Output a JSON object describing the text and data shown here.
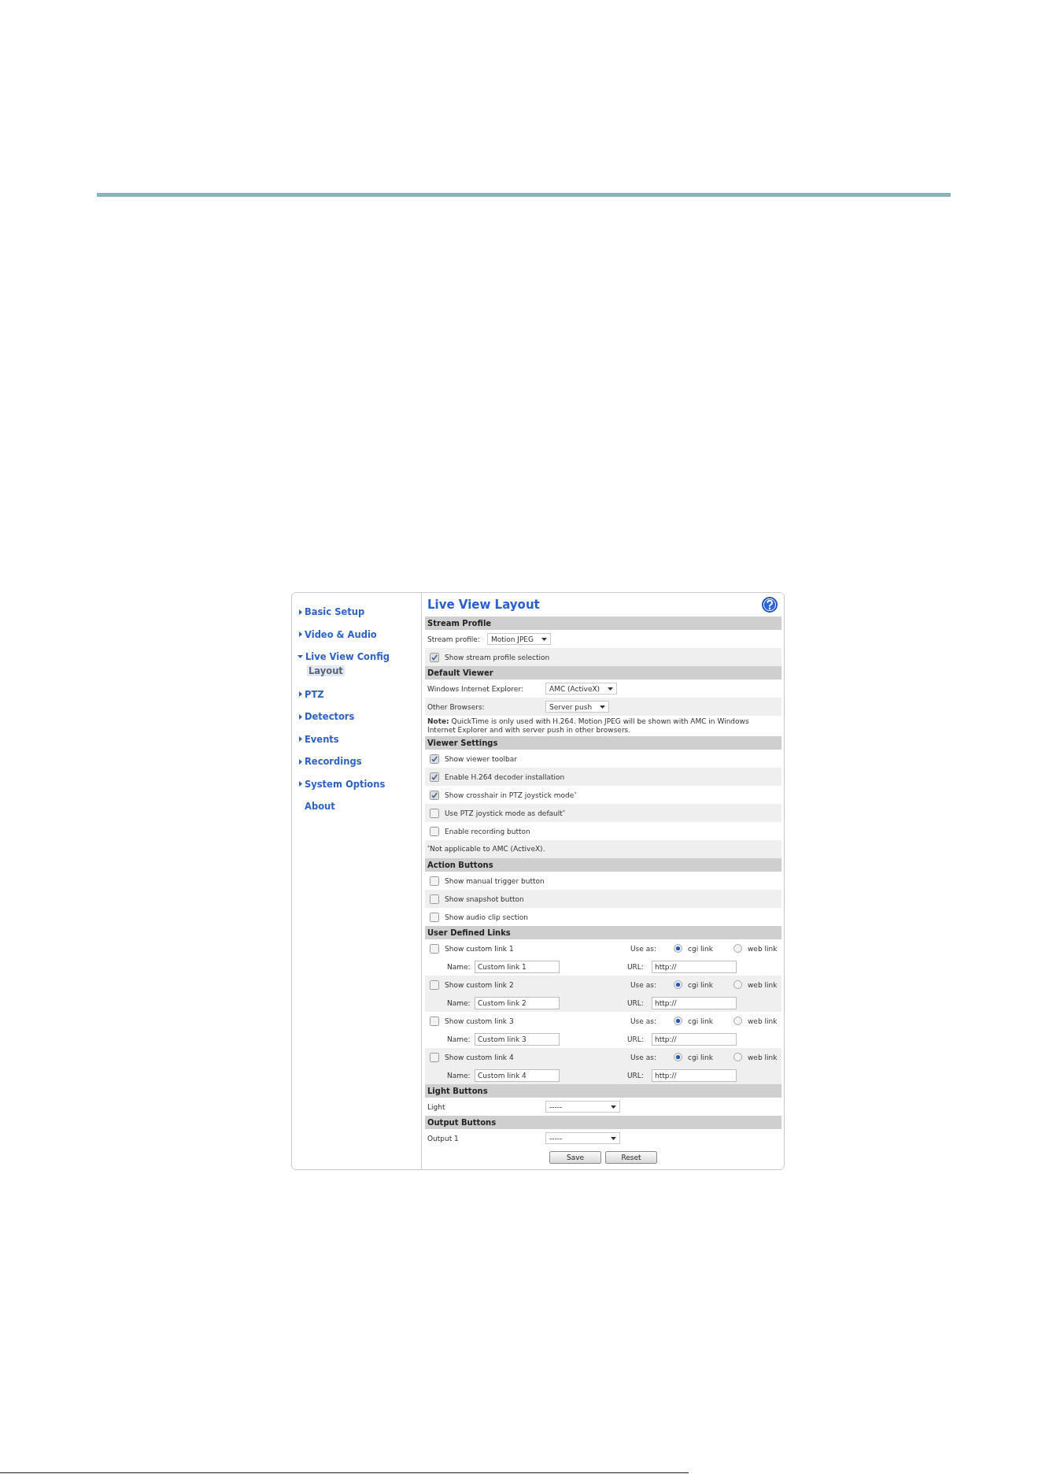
{
  "sidebar": {
    "items": [
      {
        "kind": "section",
        "label": "Basic Setup",
        "expanded": false,
        "selected": false
      },
      {
        "kind": "section",
        "label": "Video & Audio",
        "expanded": false,
        "selected": false
      },
      {
        "kind": "section",
        "label": "Live View Config",
        "expanded": true,
        "selected": false,
        "children": [
          {
            "label": "Layout",
            "selected": true
          }
        ]
      },
      {
        "kind": "section",
        "label": "PTZ",
        "expanded": false,
        "selected": false
      },
      {
        "kind": "section",
        "label": "Detectors",
        "expanded": false,
        "selected": false
      },
      {
        "kind": "section",
        "label": "Events",
        "expanded": false,
        "selected": false
      },
      {
        "kind": "section",
        "label": "Recordings",
        "expanded": false,
        "selected": false
      },
      {
        "kind": "section",
        "label": "System Options",
        "expanded": false,
        "selected": false
      },
      {
        "kind": "page",
        "label": "About",
        "selected": false
      }
    ]
  },
  "title": "Live View Layout",
  "sections": [
    {
      "heading": "Stream Profile",
      "rows": [
        {
          "kind": "inline-select",
          "label": "Stream profile:",
          "value": "Motion JPEG"
        },
        {
          "kind": "checkbox",
          "label": "Show stream profile selection",
          "checked": true
        }
      ]
    },
    {
      "heading": "Default Viewer",
      "rows": [
        {
          "kind": "select",
          "label": "Windows Internet Explorer:",
          "value": "AMC (ActiveX)"
        },
        {
          "kind": "select",
          "label": "Other Browsers:",
          "value": "Server push"
        },
        {
          "kind": "note",
          "text": "**Note:** QuickTime is only used with H.264. Motion JPEG will be shown with AMC in Windows Internet Explorer and with server push in other browsers."
        }
      ]
    },
    {
      "heading": "Viewer Settings",
      "rows": [
        {
          "kind": "checkbox",
          "label": "Show viewer toolbar",
          "checked": true
        },
        {
          "kind": "checkbox",
          "label": "Enable H.264 decoder installation",
          "checked": true
        },
        {
          "kind": "checkbox",
          "label": "Show crosshair in PTZ joystick mode$^{*}$",
          "checked": true
        },
        {
          "kind": "checkbox",
          "label": "Use PTZ joystick mode as default$^{*}$",
          "checked": false
        },
        {
          "kind": "checkbox",
          "label": "Enable recording button",
          "checked": false
        },
        {
          "kind": "note",
          "text": "$^{*}$Not applicable to AMC (ActiveX)."
        }
      ]
    },
    {
      "heading": "Action Buttons",
      "rows": [
        {
          "kind": "checkbox",
          "label": "Show manual trigger button",
          "checked": false
        },
        {
          "kind": "checkbox",
          "label": "Show snapshot button",
          "checked": false
        },
        {
          "kind": "checkbox",
          "label": "Show audio clip section",
          "checked": false
        }
      ]
    },
    {
      "heading": "User Defined Links",
      "rows": [
        {
          "kind": "custom-link",
          "label": "Show custom link 1",
          "checked": false,
          "use_as_label": "Use as:",
          "options": [
            {
              "label": "cgi link",
              "selected": true
            },
            {
              "label": "web link",
              "selected": false
            }
          ],
          "name_label": "Name:",
          "name_value": "Custom link 1",
          "url_label": "URL:",
          "url_value": "http://"
        },
        {
          "kind": "custom-link",
          "label": "Show custom link 2",
          "checked": false,
          "use_as_label": "Use as:",
          "options": [
            {
              "label": "cgi link",
              "selected": true
            },
            {
              "label": "web link",
              "selected": false
            }
          ],
          "name_label": "Name:",
          "name_value": "Custom link 2",
          "url_label": "URL:",
          "url_value": "http://"
        },
        {
          "kind": "custom-link",
          "label": "Show custom link 3",
          "checked": false,
          "use_as_label": "Use as:",
          "options": [
            {
              "label": "cgi link",
              "selected": true
            },
            {
              "label": "web link",
              "selected": false
            }
          ],
          "name_label": "Name:",
          "name_value": "Custom link 3",
          "url_label": "URL:",
          "url_value": "http://"
        },
        {
          "kind": "custom-link",
          "label": "Show custom link 4",
          "checked": false,
          "use_as_label": "Use as:",
          "options": [
            {
              "label": "cgi link",
              "selected": true
            },
            {
              "label": "web link",
              "selected": false
            }
          ],
          "name_label": "Name:",
          "name_value": "Custom link 4",
          "url_label": "URL:",
          "url_value": "http://"
        }
      ]
    },
    {
      "heading": "Light Buttons",
      "rows": [
        {
          "kind": "wide-select",
          "label": "Light",
          "value": "-----"
        }
      ]
    },
    {
      "heading": "Output Buttons",
      "rows": [
        {
          "kind": "wide-select",
          "label": "Output 1",
          "value": "-----"
        }
      ]
    }
  ],
  "buttons": [
    "Save",
    "Reset"
  ]
}
